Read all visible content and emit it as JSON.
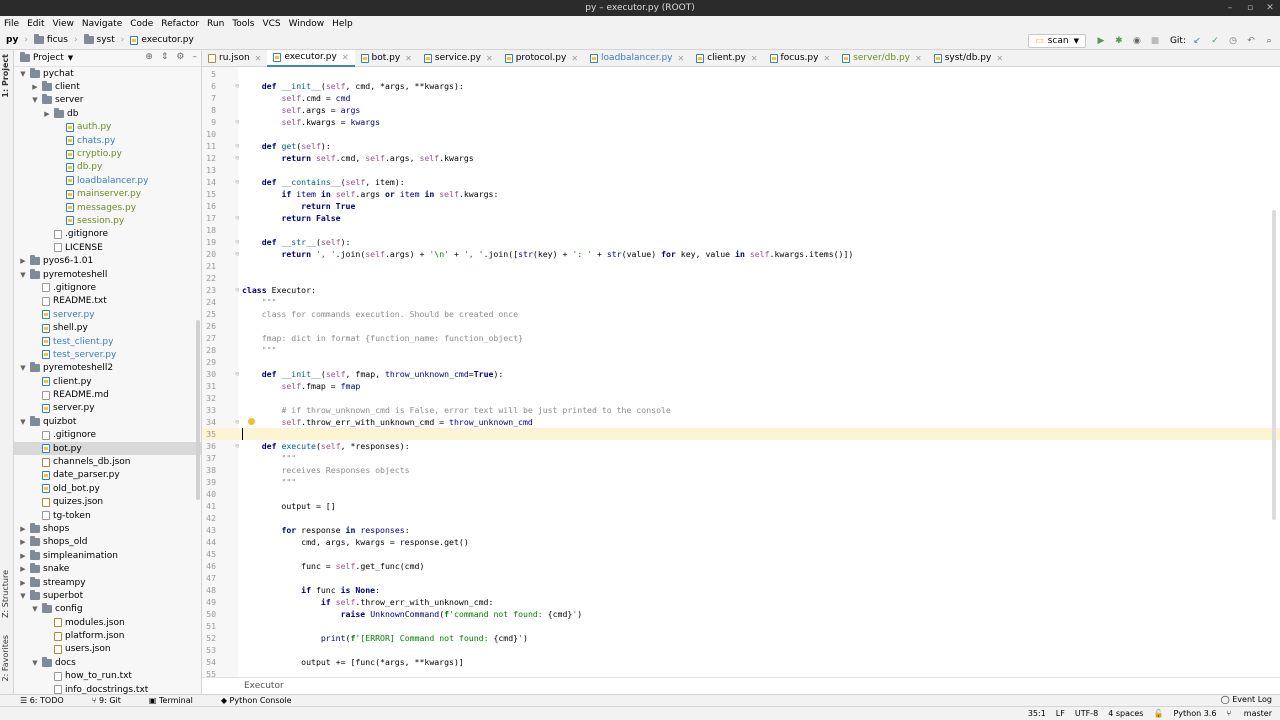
{
  "window": {
    "title": "py – executor.py (ROOT)"
  },
  "menu": [
    "File",
    "Edit",
    "View",
    "Navigate",
    "Code",
    "Refactor",
    "Run",
    "Tools",
    "VCS",
    "Window",
    "Help"
  ],
  "breadcrumb": [
    "py",
    "ficus",
    "syst",
    "executor.py"
  ],
  "toolbar": {
    "run_config": "scan",
    "git_label": "Git:"
  },
  "project": {
    "title": "Project",
    "tree": [
      {
        "label": "pychat",
        "depth": 1,
        "type": "folder",
        "open": true
      },
      {
        "label": "client",
        "depth": 2,
        "type": "folder",
        "open": false
      },
      {
        "label": "server",
        "depth": 2,
        "type": "folder",
        "open": true
      },
      {
        "label": "db",
        "depth": 3,
        "type": "folder",
        "open": false
      },
      {
        "label": "auth.py",
        "depth": 4,
        "type": "py",
        "color": "#6b8e23"
      },
      {
        "label": "chats.py",
        "depth": 4,
        "type": "py",
        "color": "#3a7dbf"
      },
      {
        "label": "cryptio.py",
        "depth": 4,
        "type": "py",
        "color": "#6b8e23"
      },
      {
        "label": "db.py",
        "depth": 4,
        "type": "py",
        "color": "#6b8e23"
      },
      {
        "label": "loadbalancer.py",
        "depth": 4,
        "type": "py",
        "color": "#3a7dbf"
      },
      {
        "label": "mainserver.py",
        "depth": 4,
        "type": "py",
        "color": "#6b8e23"
      },
      {
        "label": "messages.py",
        "depth": 4,
        "type": "py",
        "color": "#6b8e23"
      },
      {
        "label": "session.py",
        "depth": 4,
        "type": "py",
        "color": "#6b8e23"
      },
      {
        "label": ".gitignore",
        "depth": 3,
        "type": "txt",
        "color": "#000"
      },
      {
        "label": "LICENSE",
        "depth": 3,
        "type": "txt",
        "color": "#000"
      },
      {
        "label": "pyos6-1.01",
        "depth": 1,
        "type": "folder",
        "open": false
      },
      {
        "label": "pyremoteshell",
        "depth": 1,
        "type": "folder",
        "open": true
      },
      {
        "label": ".gitignore",
        "depth": 2,
        "type": "txt",
        "color": "#000"
      },
      {
        "label": "README.txt",
        "depth": 2,
        "type": "txt",
        "color": "#000"
      },
      {
        "label": "server.py",
        "depth": 2,
        "type": "py",
        "color": "#3a7dbf"
      },
      {
        "label": "shell.py",
        "depth": 2,
        "type": "py",
        "color": "#000"
      },
      {
        "label": "test_client.py",
        "depth": 2,
        "type": "py",
        "color": "#3a7dbf"
      },
      {
        "label": "test_server.py",
        "depth": 2,
        "type": "py",
        "color": "#3a7dbf"
      },
      {
        "label": "pyremoteshell2",
        "depth": 1,
        "type": "folder",
        "open": true
      },
      {
        "label": "client.py",
        "depth": 2,
        "type": "py",
        "color": "#000"
      },
      {
        "label": "README.md",
        "depth": 2,
        "type": "txt",
        "color": "#000"
      },
      {
        "label": "server.py",
        "depth": 2,
        "type": "py",
        "color": "#000"
      },
      {
        "label": "quizbot",
        "depth": 1,
        "type": "folder",
        "open": true
      },
      {
        "label": ".gitignore",
        "depth": 2,
        "type": "txt",
        "color": "#000"
      },
      {
        "label": "bot.py",
        "depth": 2,
        "type": "py",
        "color": "#000",
        "selected": true
      },
      {
        "label": "channels_db.json",
        "depth": 2,
        "type": "json",
        "color": "#000"
      },
      {
        "label": "date_parser.py",
        "depth": 2,
        "type": "py",
        "color": "#000"
      },
      {
        "label": "old_bot.py",
        "depth": 2,
        "type": "py",
        "color": "#000"
      },
      {
        "label": "quizes.json",
        "depth": 2,
        "type": "json",
        "color": "#000"
      },
      {
        "label": "tg-token",
        "depth": 2,
        "type": "txt",
        "color": "#000"
      },
      {
        "label": "shops",
        "depth": 1,
        "type": "folder",
        "open": false
      },
      {
        "label": "shops_old",
        "depth": 1,
        "type": "folder",
        "open": false
      },
      {
        "label": "simpleanimation",
        "depth": 1,
        "type": "folder",
        "open": false
      },
      {
        "label": "snake",
        "depth": 1,
        "type": "folder",
        "open": false
      },
      {
        "label": "streampy",
        "depth": 1,
        "type": "folder",
        "open": false
      },
      {
        "label": "superbot",
        "depth": 1,
        "type": "folder",
        "open": true
      },
      {
        "label": "config",
        "depth": 2,
        "type": "folder",
        "open": true
      },
      {
        "label": "modules.json",
        "depth": 3,
        "type": "json",
        "color": "#000"
      },
      {
        "label": "platform.json",
        "depth": 3,
        "type": "json",
        "color": "#000"
      },
      {
        "label": "users.json",
        "depth": 3,
        "type": "json",
        "color": "#000"
      },
      {
        "label": "docs",
        "depth": 2,
        "type": "folder",
        "open": true
      },
      {
        "label": "how_to_run.txt",
        "depth": 3,
        "type": "txt",
        "color": "#000"
      },
      {
        "label": "info_docstrings.txt",
        "depth": 3,
        "type": "txt",
        "color": "#000"
      }
    ]
  },
  "tabs": [
    {
      "label": "ru.json",
      "color": "#000",
      "type": "json"
    },
    {
      "label": "executor.py",
      "color": "#000",
      "type": "py",
      "active": true
    },
    {
      "label": "bot.py",
      "color": "#000",
      "type": "py"
    },
    {
      "label": "service.py",
      "color": "#000",
      "type": "py"
    },
    {
      "label": "protocol.py",
      "color": "#000",
      "type": "py"
    },
    {
      "label": "loadbalancer.py",
      "color": "#3a7dbf",
      "type": "py"
    },
    {
      "label": "client.py",
      "color": "#000",
      "type": "py"
    },
    {
      "label": "focus.py",
      "color": "#000",
      "type": "py"
    },
    {
      "label": "server/db.py",
      "color": "#6b8e23",
      "type": "py"
    },
    {
      "label": "syst/db.py",
      "color": "#000",
      "type": "py"
    }
  ],
  "code": [
    {
      "n": "5",
      "h": ""
    },
    {
      "n": "6",
      "h": "    <span class='k'>def</span> <span class='f'>__init__</span>(<span class='self'>self</span>, cmd, *args, **kwargs):"
    },
    {
      "n": "7",
      "h": "        <span class='self'>self</span>.cmd = <span class='kw'>cmd</span>"
    },
    {
      "n": "8",
      "h": "        <span class='self'>self</span>.args = <span class='kw'>args</span>"
    },
    {
      "n": "9",
      "h": "        <span class='self'>self</span>.kwargs = <span class='kw'>kwargs</span>"
    },
    {
      "n": "10",
      "h": ""
    },
    {
      "n": "11",
      "h": "    <span class='k'>def</span> <span class='f'>get</span>(<span class='self'>self</span>):"
    },
    {
      "n": "12",
      "h": "        <span class='k'>return</span> <span class='self'>self</span>.cmd, <span class='self'>self</span>.args, <span class='self'>self</span>.kwargs"
    },
    {
      "n": "13",
      "h": ""
    },
    {
      "n": "14",
      "h": "    <span class='k'>def</span> <span class='f'>__contains__</span>(<span class='self'>self</span>, item):"
    },
    {
      "n": "15",
      "h": "        <span class='k'>if</span> <span class='kw'>item</span> <span class='k'>in</span> <span class='self'>self</span>.args <span class='k'>or</span> <span class='kw'>item</span> <span class='k'>in</span> <span class='self'>self</span>.kwargs:"
    },
    {
      "n": "16",
      "h": "            <span class='k'>return True</span>"
    },
    {
      "n": "17",
      "h": "        <span class='k'>return False</span>"
    },
    {
      "n": "18",
      "h": ""
    },
    {
      "n": "19",
      "h": "    <span class='k'>def</span> <span class='f'>__str__</span>(<span class='self'>self</span>):"
    },
    {
      "n": "20",
      "h": "        <span class='k'>return</span> <span class='s'>', '</span>.join(<span class='self'>self</span>.args) + <span class='s'>'\\n'</span> + <span class='s'>', '</span>.join([<span class='bi'>str</span>(key) + <span class='s'>': '</span> + <span class='bi'>str</span>(value) <span class='k'>for</span> key, value <span class='k'>in</span> <span class='self'>self</span>.kwargs.items()])"
    },
    {
      "n": "21",
      "h": ""
    },
    {
      "n": "22",
      "h": ""
    },
    {
      "n": "23",
      "h": "<span class='k'>class</span> Executor:"
    },
    {
      "n": "24",
      "h": "    <span class='c'>\"\"\"</span>"
    },
    {
      "n": "25",
      "h": "    <span class='c'>class for commands execution. Should be created once</span>"
    },
    {
      "n": "26",
      "h": ""
    },
    {
      "n": "27",
      "h": "    <span class='c'>fmap: dict in format {function_name: function_object}</span>"
    },
    {
      "n": "28",
      "h": "    <span class='c'>\"\"\"</span>"
    },
    {
      "n": "29",
      "h": ""
    },
    {
      "n": "30",
      "h": "    <span class='k'>def</span> <span class='f'>__init__</span>(<span class='self'>self</span>, fmap, <span class='kw'>throw_unknown_cmd</span>=<span class='k'>True</span>):"
    },
    {
      "n": "31",
      "h": "        <span class='self'>self</span>.fmap = <span class='kw'>fmap</span>"
    },
    {
      "n": "32",
      "h": ""
    },
    {
      "n": "33",
      "h": "        <span class='c'># if throw_unknown_cmd is False, error text will be just printed to the console</span>"
    },
    {
      "n": "34",
      "h": "        <span class='self'>self</span>.throw_err_with_unknown_cmd = <span class='kw'>throw_unknown_cmd</span>"
    },
    {
      "n": "35",
      "h": "",
      "current": true
    },
    {
      "n": "36",
      "h": "    <span class='k'>def</span> <span class='f'>execute</span>(<span class='self'>self</span>, *responses):"
    },
    {
      "n": "37",
      "h": "        <span class='c'>\"\"\"</span>"
    },
    {
      "n": "38",
      "h": "        <span class='c'>receives Responses objects</span>"
    },
    {
      "n": "39",
      "h": "        <span class='c'>\"\"\"</span>"
    },
    {
      "n": "40",
      "h": ""
    },
    {
      "n": "41",
      "h": "        output = []"
    },
    {
      "n": "42",
      "h": ""
    },
    {
      "n": "43",
      "h": "        <span class='k'>for</span> response <span class='k'>in</span> <span class='kw'>responses</span>:"
    },
    {
      "n": "44",
      "h": "            cmd, args, kwargs = response.get()"
    },
    {
      "n": "45",
      "h": ""
    },
    {
      "n": "46",
      "h": "            func = <span class='self'>self</span>.get_func(cmd)"
    },
    {
      "n": "47",
      "h": ""
    },
    {
      "n": "48",
      "h": "            <span class='k'>if</span> func <span class='k'>is None</span>:"
    },
    {
      "n": "49",
      "h": "                <span class='k'>if</span> <span class='self'>self</span>.throw_err_with_unknown_cmd:"
    },
    {
      "n": "50",
      "h": "                    <span class='k'>raise</span> <span class='kw'>UnknownCommand</span>(<span class='s'><b>f</b>'command not found: </span>{cmd}<span class='s'>'</span>)"
    },
    {
      "n": "51",
      "h": ""
    },
    {
      "n": "52",
      "h": "                <span class='bi'>print</span>(<span class='s'><b>f</b>'[ERROR] Command not found: </span>{cmd}<span class='s'>'</span>)"
    },
    {
      "n": "53",
      "h": ""
    },
    {
      "n": "54",
      "h": "            output += [func(*args, **kwargs)]"
    },
    {
      "n": "55",
      "h": ""
    }
  ],
  "editor_breadcrumb": "Executor",
  "toolwindows": [
    "6: TODO",
    "9: Git",
    "Terminal",
    "Python Console"
  ],
  "event_log": "Event Log",
  "status": {
    "position": "35:1",
    "line_sep": "LF",
    "encoding": "UTF-8",
    "indent": "4 spaces",
    "interpreter": "Python 3.6",
    "branch": "master"
  },
  "sidebar_tabs": [
    "1: Project",
    "Z: Structure",
    "2: Favorites"
  ]
}
